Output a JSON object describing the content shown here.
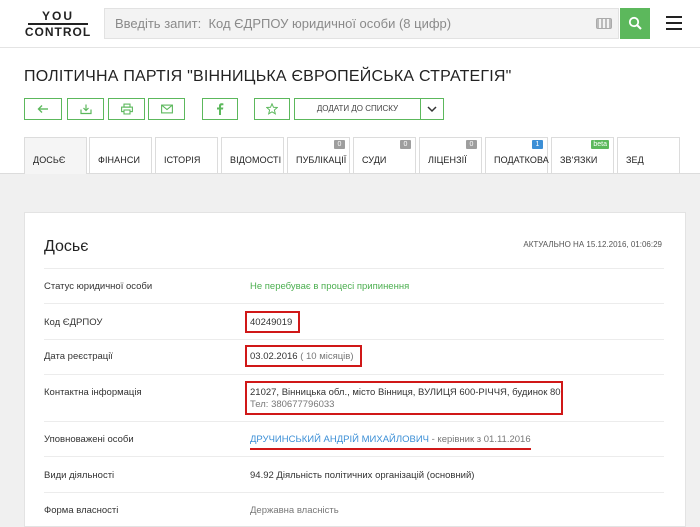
{
  "header": {
    "logo_top": "YOU",
    "logo_bottom": "CONTROL",
    "search_placeholder": "Введіть запит:  Код ЄДРПОУ юридичної особи (8 цифр)"
  },
  "company": {
    "title": "ПОЛІТИЧНА ПАРТІЯ \"ВІННИЦЬКА ЄВРОПЕЙСЬКА СТРАТЕГІЯ\""
  },
  "toolbar": {
    "add_to_list": "ДОДАТИ ДО СПИСКУ"
  },
  "tabs": [
    {
      "label": "ДОСЬЄ"
    },
    {
      "label": "ФІНАНСИ"
    },
    {
      "label": "ІСТОРІЯ"
    },
    {
      "label": "ВІДОМОСТІ"
    },
    {
      "label": "ПУБЛІКАЦІЇ",
      "badge": "0"
    },
    {
      "label": "СУДИ",
      "badge": "0"
    },
    {
      "label": "ЛІЦЕНЗІЇ",
      "badge": "0"
    },
    {
      "label": "ПОДАТКОВА",
      "badge": "1"
    },
    {
      "label": "ЗВ'ЯЗКИ",
      "badge": "beta"
    },
    {
      "label": "ЗЕД"
    }
  ],
  "dossier": {
    "heading": "Досьє",
    "actual": "АКТУАЛЬНО НА 15.12.2016, 01:06:29",
    "status_label": "Статус юридичної особи",
    "status_value": "Не перебуває в процесі припинення",
    "code_label": "Код ЄДРПОУ",
    "code_value": "40249019",
    "reg_label": "Дата реєстрації",
    "reg_date": "03.02.2016",
    "reg_age": "( 10 місяців)",
    "contact_label": "Контактна інформація",
    "address": "21027, Вінницька обл., місто Вінниця, ВУЛИЦЯ 600-РІЧЧЯ, будинок 80",
    "phone_label": "Тел:",
    "phone": "380677796033",
    "persons_label": "Уповноважені особи",
    "person_name": "ДРУЧИНСЬКИЙ АНДРІЙ МИХАЙЛОВИЧ",
    "person_role": "- керівник з 01.11.2016",
    "activity_label": "Види діяльності",
    "activity_value": "94.92 Діяльність політичних організацій (основний)",
    "ownership_label": "Форма власності",
    "ownership_value": "Державна власність"
  },
  "colors": {
    "accent_green": "#5cb85c",
    "link_blue": "#3c8fd6",
    "highlight_red": "#d01818"
  }
}
